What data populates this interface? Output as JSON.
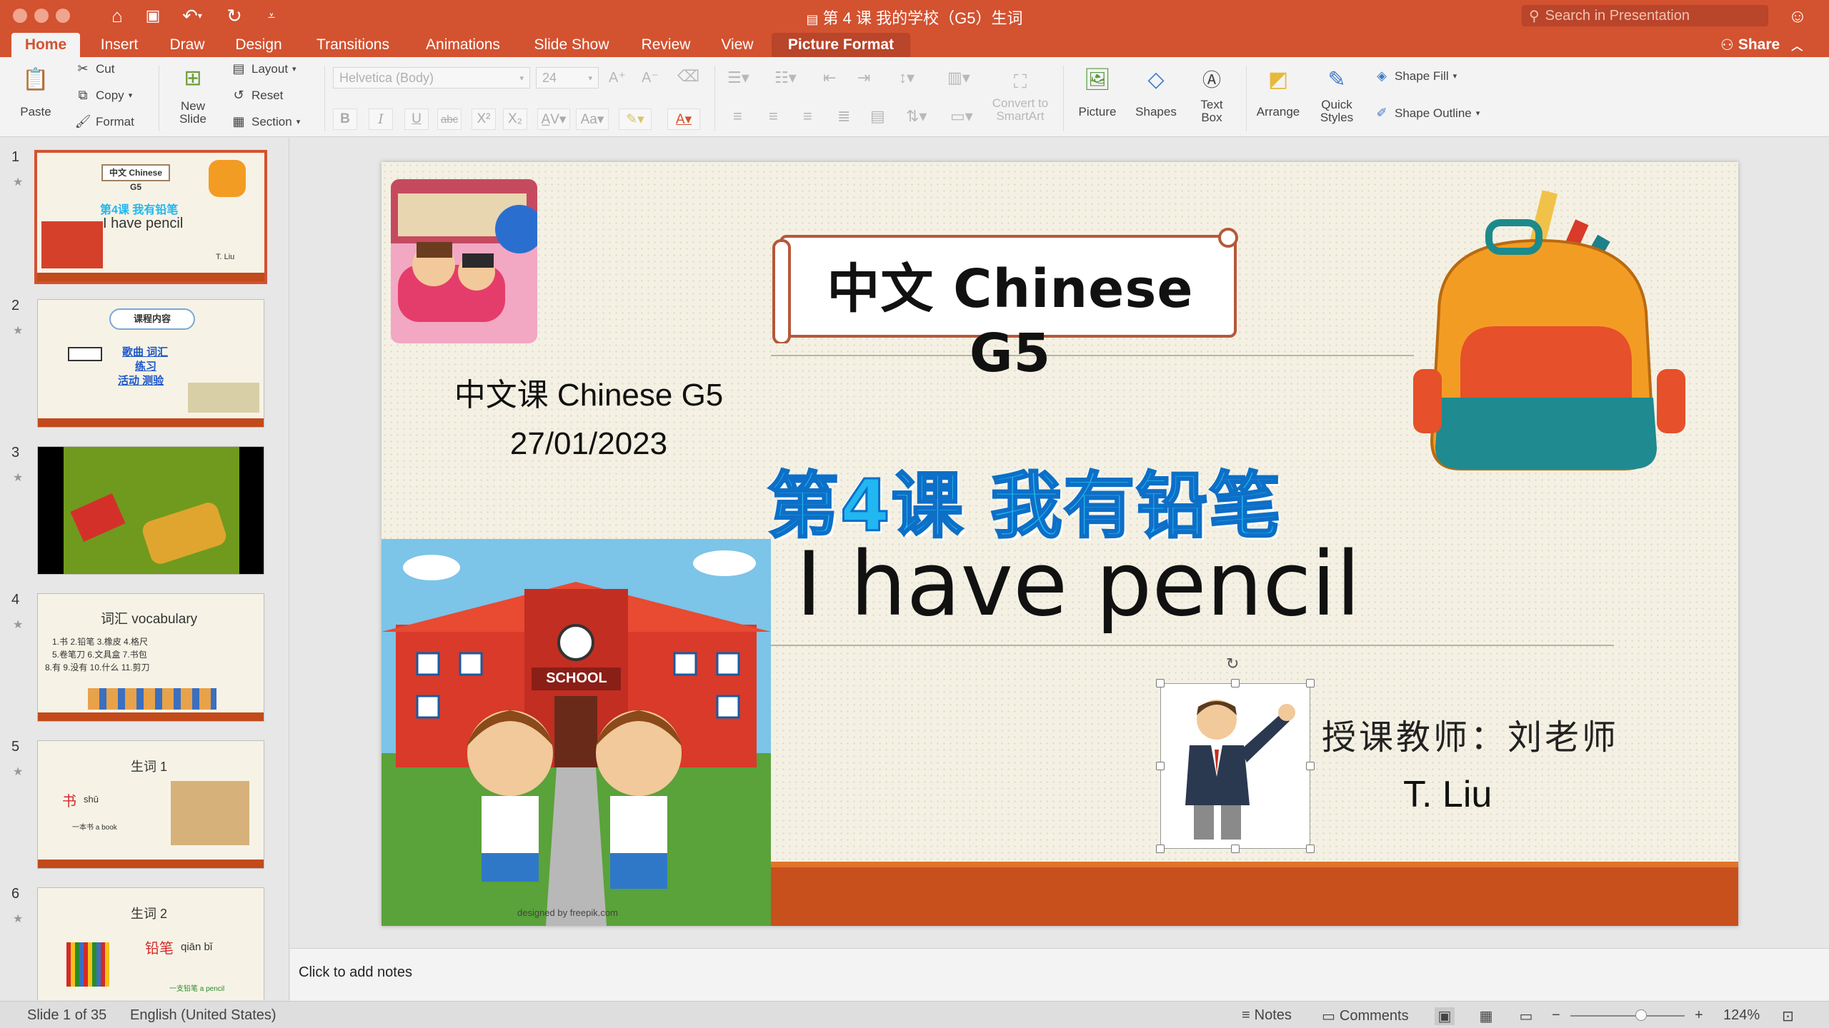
{
  "window": {
    "title": "第 4 课 我的学校（G5）生词",
    "search_placeholder": "Search in Presentation",
    "share_label": "Share"
  },
  "tabs": [
    {
      "label": "Home",
      "active": true
    },
    {
      "label": "Insert"
    },
    {
      "label": "Draw"
    },
    {
      "label": "Design"
    },
    {
      "label": "Transitions"
    },
    {
      "label": "Animations"
    },
    {
      "label": "Slide Show"
    },
    {
      "label": "Review"
    },
    {
      "label": "View"
    },
    {
      "label": "Picture Format",
      "contextual": true
    }
  ],
  "ribbon": {
    "paste": "Paste",
    "cut": "Cut",
    "copy": "Copy",
    "format": "Format",
    "new_slide_1": "New",
    "new_slide_2": "Slide",
    "layout": "Layout",
    "reset": "Reset",
    "section": "Section",
    "font_name": "Helvetica (Body)",
    "font_size": "24",
    "convert_1": "Convert to",
    "convert_2": "SmartArt",
    "picture": "Picture",
    "shapes": "Shapes",
    "textbox_1": "Text",
    "textbox_2": "Box",
    "arrange": "Arrange",
    "quick_styles_1": "Quick",
    "quick_styles_2": "Styles",
    "shape_fill": "Shape Fill",
    "shape_outline": "Shape Outline"
  },
  "thumbnails": [
    {
      "num": "1",
      "selected": true,
      "caption_a": "中文 Chinese G5",
      "caption_b": "第4课 我有铅笔",
      "caption_c": "I have pencil",
      "caption_d": "T. Liu"
    },
    {
      "num": "2",
      "caption_a": "课程内容",
      "caption_b": "歌曲 词汇",
      "caption_c": "练习",
      "caption_d": "活动 测验"
    },
    {
      "num": "3"
    },
    {
      "num": "4",
      "caption_a": "词汇 vocabulary",
      "caption_b": "1.书  2.铅笔  3.橡皮  4.格尺",
      "caption_c": "5.卷笔刀  6.文具盒  7.书包",
      "caption_d": "8.有  9.没有  10.什么  11.剪刀"
    },
    {
      "num": "5",
      "caption_a": "生词 1",
      "caption_b": "书",
      "caption_c": "shū",
      "caption_d": "一本书  a book"
    },
    {
      "num": "6",
      "caption_a": "生词 2",
      "caption_b": "铅笔",
      "caption_c": "qiān bǐ",
      "caption_d": "一支铅笔 a pencil"
    }
  ],
  "slide": {
    "banner": "中文 Chinese G5",
    "course": "中文课 Chinese G5",
    "date": "27/01/2023",
    "lesson_title": "第4课 我有铅笔",
    "lesson_sub": "I have pencil",
    "teacher_label": "授课教师：刘老师",
    "teacher_name": "T. Liu",
    "school_sign": "SCHOOL",
    "credit": "designed by freepik.com"
  },
  "notes_placeholder": "Click to add notes",
  "status": {
    "slide_info": "Slide 1 of 35",
    "language": "English (United States)",
    "notes": "Notes",
    "comments": "Comments",
    "zoom": "124%",
    "zoom_fraction": 0.62
  },
  "colors": {
    "accent": "#d35230",
    "slide_band": "#c8501c",
    "title_blue": "#21b7f0"
  }
}
